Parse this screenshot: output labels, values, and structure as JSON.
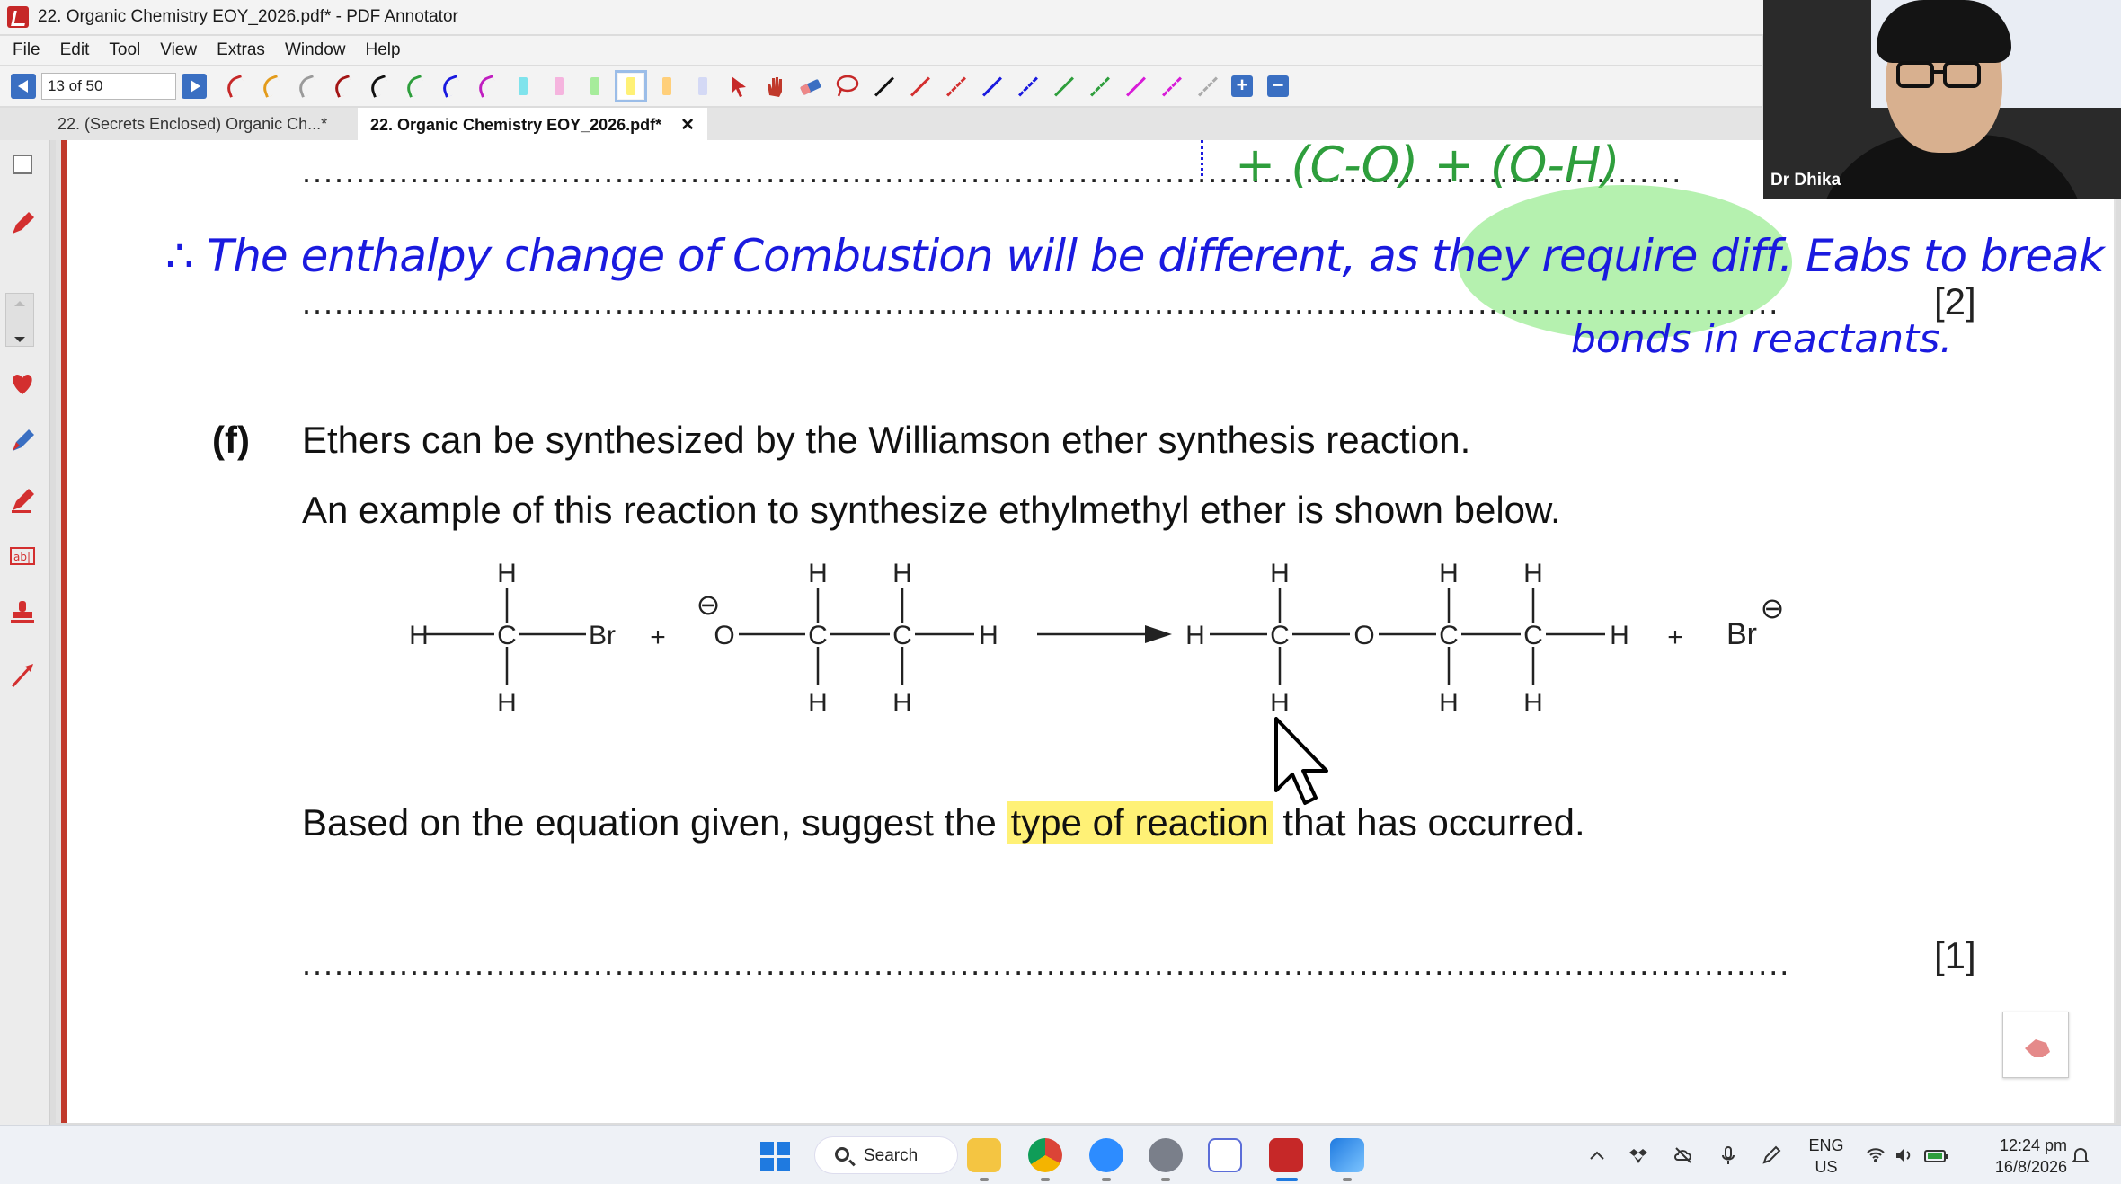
{
  "window": {
    "title": "22. Organic Chemistry EOY_2026.pdf* - PDF Annotator"
  },
  "menu": [
    "File",
    "Edit",
    "Tool",
    "View",
    "Extras",
    "Window",
    "Help"
  ],
  "toolbar": {
    "page_field": "13 of 50"
  },
  "tabs": [
    {
      "label": "22. (Secrets Enclosed) Organic Ch...*"
    },
    {
      "label": "22. Organic Chemistry EOY_2026.pdf*"
    }
  ],
  "document": {
    "top_handwriting_green": "+ (C-O) + (O-H)",
    "handwritten_answer_line1": "∴ The enthalpy change of Combustion will be different, as they require diff. Eabs to break",
    "handwritten_answer_line2": "bonds in reactants.",
    "mark_prev": "[2]",
    "question_label": "(f)",
    "question_line1": "Ethers can be synthesized by the Williamson ether synthesis reaction.",
    "question_line2": "An example of this reaction to synthesize ethylmethyl ether is shown below.",
    "question_line3_before": "Based on the equation given, suggest the ",
    "question_line3_highlight": "type of reaction",
    "question_line3_after": " that has occurred.",
    "mark_f": "[1]",
    "answer_dots": "..........................................................................................................................................",
    "answer_dots_prev": ".........................................................................................................................................",
    "answer_dots_top": "................................................................................................................................"
  },
  "equation": {
    "atoms": {
      "H": "H",
      "C": "C",
      "O": "O",
      "Br": "Br",
      "plus": "+",
      "minus": "⊖"
    }
  },
  "webcam": {
    "name": "Dr Dhika"
  },
  "taskbar": {
    "search_label": "Search",
    "lang_top": "ENG",
    "lang_bottom": "US",
    "time": "12:24 pm",
    "date": "16/8/2026"
  },
  "colors": {
    "ink_blue": "#1a1adf",
    "ink_green": "#2e9e3c",
    "highlight": "#fff176",
    "accent": "#3a6fc2",
    "page_border": "#c0392b"
  }
}
